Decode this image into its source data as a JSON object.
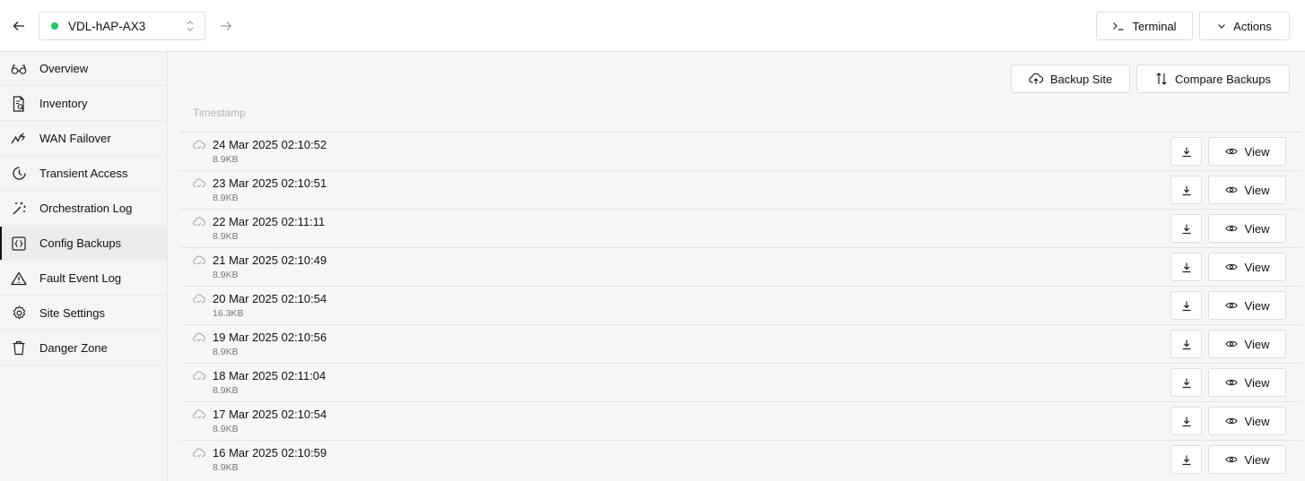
{
  "topbar": {
    "site_name": "VDL-hAP-AX3",
    "site_status_color": "#22c55e",
    "back_icon": "arrow-left-icon",
    "forward_icon": "arrow-right-icon",
    "terminal_label": "Terminal",
    "actions_label": "Actions"
  },
  "sidebar": {
    "items": [
      {
        "label": "Overview",
        "icon": "glasses-icon"
      },
      {
        "label": "Inventory",
        "icon": "document-search-icon"
      },
      {
        "label": "WAN Failover",
        "icon": "activity-zap-icon"
      },
      {
        "label": "Transient Access",
        "icon": "clock-icon"
      },
      {
        "label": "Orchestration Log",
        "icon": "magic-wand-icon"
      },
      {
        "label": "Config Backups",
        "icon": "code-braces-icon",
        "active": true
      },
      {
        "label": "Fault Event Log",
        "icon": "warning-triangle-icon"
      },
      {
        "label": "Site Settings",
        "icon": "gear-icon"
      },
      {
        "label": "Danger Zone",
        "icon": "trash-icon"
      }
    ]
  },
  "main": {
    "backup_site_label": "Backup Site",
    "compare_backups_label": "Compare Backups",
    "column_header": "Timestamp",
    "view_label": "View",
    "rows": [
      {
        "timestamp": "24 Mar 2025 02:10:52",
        "size": "8.9KB"
      },
      {
        "timestamp": "23 Mar 2025 02:10:51",
        "size": "8.9KB"
      },
      {
        "timestamp": "22 Mar 2025 02:11:11",
        "size": "8.9KB"
      },
      {
        "timestamp": "21 Mar 2025 02:10:49",
        "size": "8.9KB"
      },
      {
        "timestamp": "20 Mar 2025 02:10:54",
        "size": "16.3KB"
      },
      {
        "timestamp": "19 Mar 2025 02:10:56",
        "size": "8.9KB"
      },
      {
        "timestamp": "18 Mar 2025 02:11:04",
        "size": "8.9KB"
      },
      {
        "timestamp": "17 Mar 2025 02:10:54",
        "size": "8.9KB"
      },
      {
        "timestamp": "16 Mar 2025 02:10:59",
        "size": "8.9KB"
      }
    ]
  }
}
